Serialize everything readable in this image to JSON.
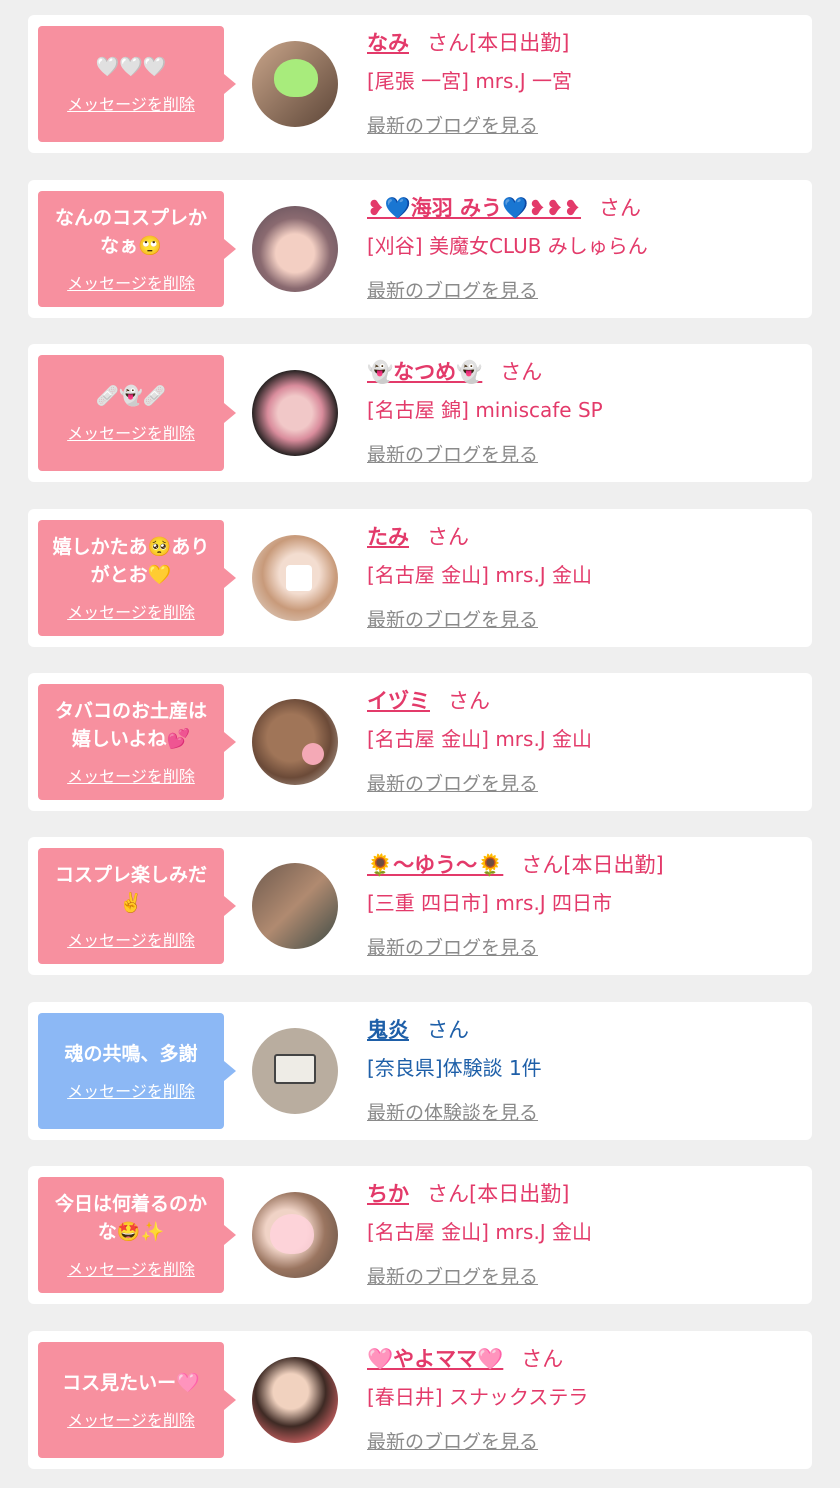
{
  "colors": {
    "pink_bubble": "#f7909f",
    "blue_bubble": "#8cb8f5",
    "pink_text": "#e33a6a",
    "blue_text": "#1e5fa8"
  },
  "cards": [
    {
      "message": "🤍🤍🤍",
      "delete_label": "メッセージを削除",
      "name": "なみ",
      "honorific": "さん[本日出勤]",
      "shop": "[尾張 一宮] mrs.J 一宮",
      "blog_link": "最新のブログを見る",
      "theme": "pink"
    },
    {
      "message": "なんのコスプレかなぁ🙄",
      "delete_label": "メッセージを削除",
      "name": "❥💙海羽 みう💙❥❥❥",
      "honorific": "さん",
      "shop": "[刈谷] 美魔女CLUB みしゅらん",
      "blog_link": "最新のブログを見る",
      "theme": "pink"
    },
    {
      "message": "🩹👻🩹",
      "delete_label": "メッセージを削除",
      "name": "👻なつめ👻",
      "honorific": "さん",
      "shop": "[名古屋 錦] miniscafe SP",
      "blog_link": "最新のブログを見る",
      "theme": "pink"
    },
    {
      "message": "嬉しかたあ🥺ありがとお💛",
      "delete_label": "メッセージを削除",
      "name": "たみ",
      "honorific": "さん",
      "shop": "[名古屋 金山] mrs.J 金山",
      "blog_link": "最新のブログを見る",
      "theme": "pink"
    },
    {
      "message": "タバコのお土産は嬉しいよね💕",
      "delete_label": "メッセージを削除",
      "name": "イヅミ",
      "honorific": "さん",
      "shop": "[名古屋 金山] mrs.J 金山",
      "blog_link": "最新のブログを見る",
      "theme": "pink"
    },
    {
      "message": "コスプレ楽しみだ✌️",
      "delete_label": "メッセージを削除",
      "name": "🌻〜ゆう〜🌻",
      "honorific": "さん[本日出勤]",
      "shop": "[三重 四日市] mrs.J 四日市",
      "blog_link": "最新のブログを見る",
      "theme": "pink"
    },
    {
      "message": "魂の共鳴、多謝",
      "delete_label": "メッセージを削除",
      "name": "鬼炎",
      "honorific": "さん",
      "shop": "[奈良県]体験談 1件",
      "blog_link": "最新の体験談を見る",
      "theme": "blue"
    },
    {
      "message": "今日は何着るのかな🤩✨",
      "delete_label": "メッセージを削除",
      "name": "ちか",
      "honorific": "さん[本日出勤]",
      "shop": "[名古屋 金山] mrs.J 金山",
      "blog_link": "最新のブログを見る",
      "theme": "pink"
    },
    {
      "message": "コス見たいー🩷",
      "delete_label": "メッセージを削除",
      "name": "🩷やよママ🩷",
      "honorific": "さん",
      "shop": "[春日井] スナックステラ",
      "blog_link": "最新のブログを見る",
      "theme": "pink"
    }
  ]
}
